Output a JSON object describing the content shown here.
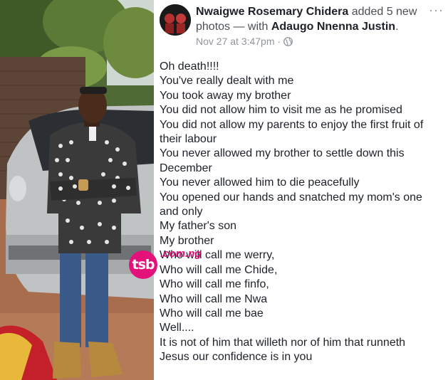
{
  "post": {
    "author": "Nwaigwe Rosemary Chidera",
    "action": "added 5 new photos — with",
    "tagged": "Adaugo Nnenna Justin",
    "tagged_suffix": ".",
    "timestamp": "Nov 27 at 3:47pm",
    "separator": "·",
    "more_icon": "ellipsis-icon",
    "privacy_icon": "globe-icon",
    "lines": [
      "Oh death!!!!",
      "You've really dealt with me",
      "You took away my brother",
      "You did not allow him to visit me as he promised",
      "You did not allow my parents to enjoy the first fruit of",
      "their labour",
      "You never allowed my brother to settle down this",
      "December",
      "You never allowed him to die peacefully",
      "You opened our hands and snatched my mom's one",
      "and only",
      "My father's son",
      "My brother",
      "Who will call me werry,",
      "Who will call me Chide,",
      "Who will call me finfo,",
      "Who will call me Nwa",
      "Who will call me bae",
      "Well....",
      "It is not of him that willeth nor of him that runneth",
      "Jesus our confidence is in you"
    ]
  },
  "watermark": {
    "logo": "tsb",
    "domain": ".com.ng",
    "color": "#e2127a"
  }
}
